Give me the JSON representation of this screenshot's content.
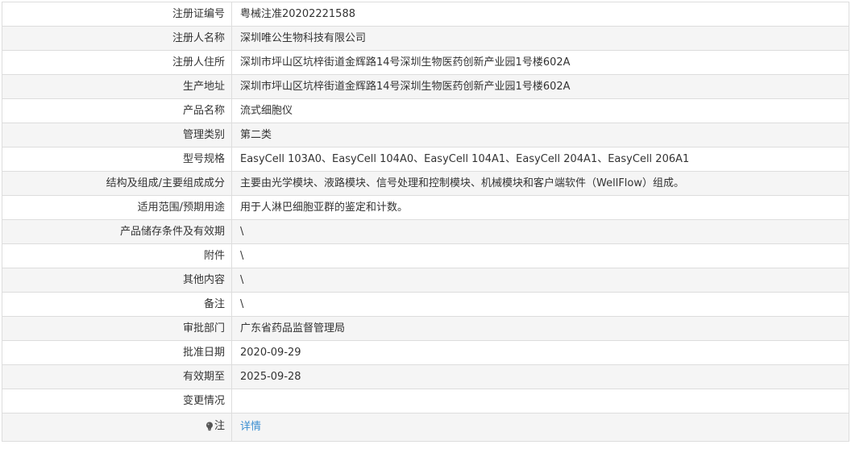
{
  "rows": [
    {
      "label": "注册证编号",
      "value": "粤械注准20202221588"
    },
    {
      "label": "注册人名称",
      "value": "深圳唯公生物科技有限公司"
    },
    {
      "label": "注册人住所",
      "value": "深圳市坪山区坑梓街道金辉路14号深圳生物医药创新产业园1号楼602A"
    },
    {
      "label": "生产地址",
      "value": "深圳市坪山区坑梓街道金辉路14号深圳生物医药创新产业园1号楼602A"
    },
    {
      "label": "产品名称",
      "value": "流式细胞仪"
    },
    {
      "label": "管理类别",
      "value": "第二类"
    },
    {
      "label": "型号规格",
      "value": "EasyCell 103A0、EasyCell 104A0、EasyCell 104A1、EasyCell 204A1、EasyCell 206A1"
    },
    {
      "label": "结构及组成/主要组成成分",
      "value": "主要由光学模块、液路模块、信号处理和控制模块、机械模块和客户端软件（WellFlow）组成。"
    },
    {
      "label": "适用范围/预期用途",
      "value": "用于人淋巴细胞亚群的鉴定和计数。"
    },
    {
      "label": "产品储存条件及有效期",
      "value": "\\"
    },
    {
      "label": "附件",
      "value": "\\"
    },
    {
      "label": "其他内容",
      "value": "\\"
    },
    {
      "label": "备注",
      "value": "\\"
    },
    {
      "label": "审批部门",
      "value": "广东省药品监督管理局"
    },
    {
      "label": "批准日期",
      "value": "2020-09-29"
    },
    {
      "label": "有效期至",
      "value": "2025-09-28"
    },
    {
      "label": "变更情况",
      "value": ""
    }
  ],
  "note": {
    "label": "注",
    "icon": "lightbulb-icon",
    "link_text": "详情",
    "link_color": "#3b8fd1"
  }
}
